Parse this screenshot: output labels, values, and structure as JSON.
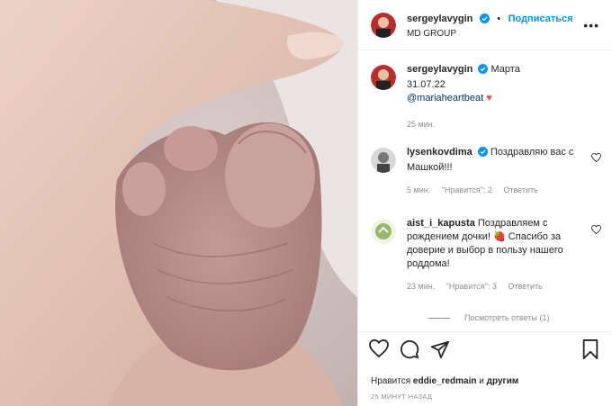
{
  "header": {
    "username": "sergeylavygin",
    "follow_label": "Подписаться",
    "location": "MD GROUP",
    "more_label": "•••"
  },
  "caption": {
    "username": "sergeylavygin",
    "text": "Марта",
    "date": "31.07.22",
    "mention": "@mariaheartbeat",
    "emoji": "❤️",
    "time": "25 мин."
  },
  "comments": [
    {
      "username": "lysenkovdima",
      "text": "Поздравляю вас с Машкой!!!",
      "time": "5 мин.",
      "likes": "\"Нравится\": 2",
      "reply": "Ответить"
    },
    {
      "username": "aist_i_kapusta",
      "text": "Поздравляем с рождением дочки! 🍓 Спасибо за доверие и выбор в пользу нашего роддома!",
      "time": "23 мин.",
      "likes": "\"Нравится\": 3",
      "reply": "Ответить",
      "view_replies": "Посмотреть ответы (1)"
    }
  ],
  "footer": {
    "likes_prefix": "Нравится",
    "likes_user": "eddie_redmain",
    "likes_and": "и",
    "likes_others": "другим",
    "timestamp": "25 МИНУТ НАЗАД"
  },
  "colors": {
    "link": "#0095f6",
    "verified": "#0095f6",
    "muted": "#8e8e8e",
    "heart": "#ed4956"
  }
}
